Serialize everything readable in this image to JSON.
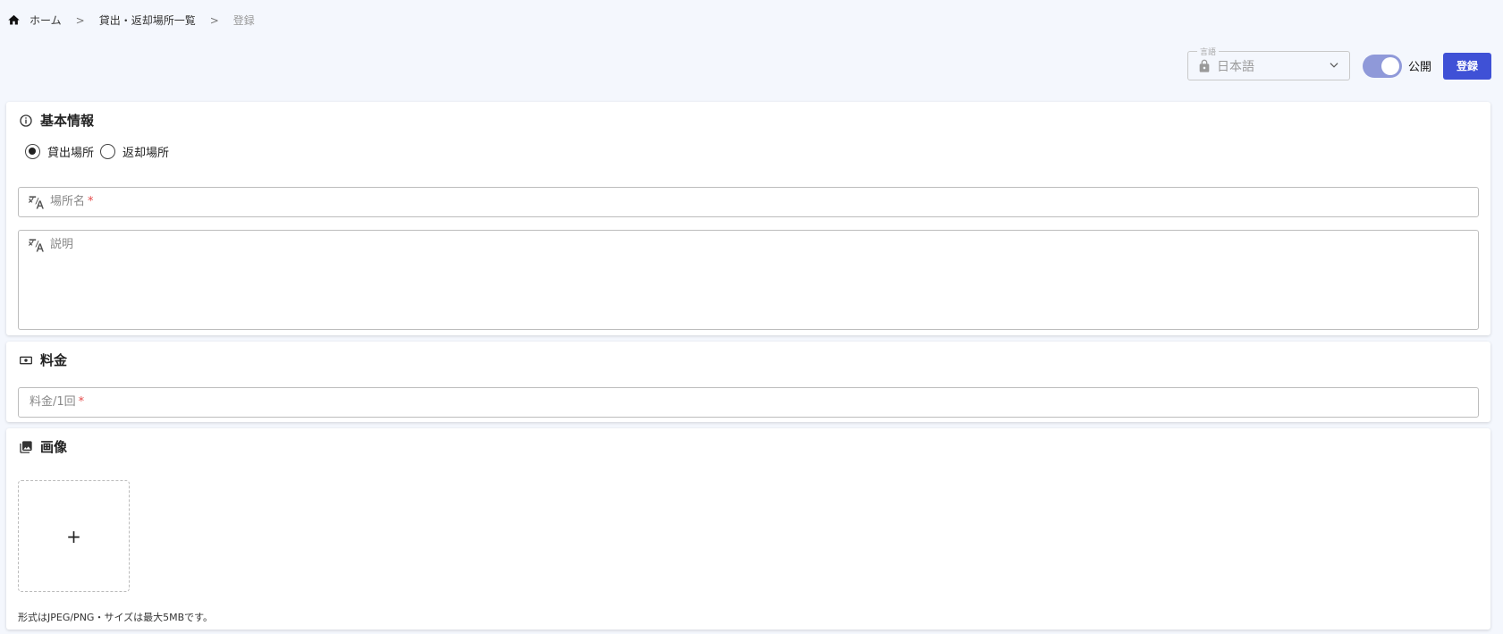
{
  "breadcrumb": {
    "home": "ホーム",
    "list": "貸出・返却場所一覧",
    "current": "登録",
    "separator": ">"
  },
  "toolbar": {
    "language_legend": "言語",
    "language_value": "日本語",
    "publish_label": "公開",
    "publish_on": true,
    "submit_label": "登録"
  },
  "basic_info": {
    "title": "基本情報",
    "radio_options": [
      {
        "label": "貸出場所",
        "checked": true
      },
      {
        "label": "返却場所",
        "checked": false
      }
    ],
    "name_placeholder": "場所名",
    "required_mark": "*",
    "description_placeholder": "説明"
  },
  "fee": {
    "title": "料金",
    "fee_placeholder": "料金/1回",
    "required_mark": "*"
  },
  "images": {
    "title": "画像",
    "add_symbol": "+",
    "note": "形式はJPEG/PNG・サイズは最大5MBです。"
  },
  "colors": {
    "accent": "#3f51d6",
    "toggle_track": "#8f99d9",
    "background": "#f4f7fd",
    "required": "#e54b4b"
  }
}
